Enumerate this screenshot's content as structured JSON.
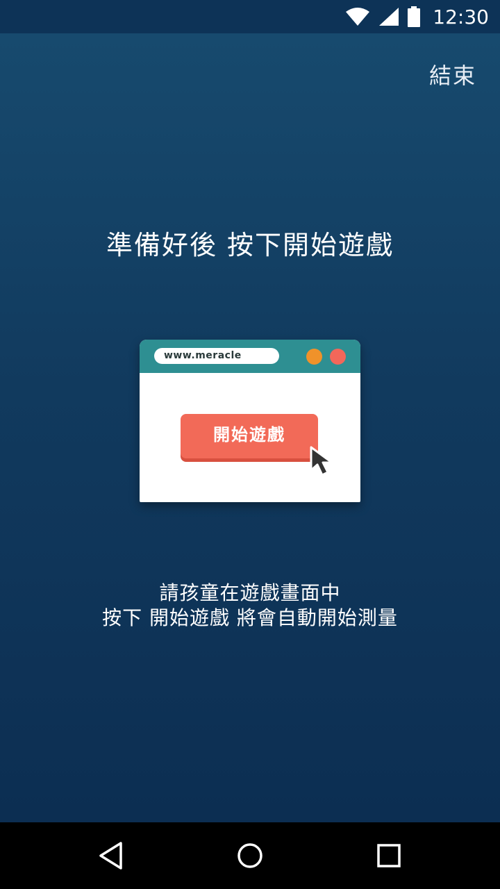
{
  "status_bar": {
    "time": "12:30",
    "icons": [
      "wifi-icon",
      "cellular-signal-icon",
      "battery-icon"
    ]
  },
  "header": {
    "end_label": "結束"
  },
  "main": {
    "headline": "準備好後 按下開始遊戲",
    "illustration": {
      "url_text": "www.meracle",
      "button_label": "開始遊戲",
      "icons": [
        "cursor-icon"
      ]
    },
    "instructions": {
      "line1": "請孩童在遊戲畫面中",
      "line2": "按下 開始遊戲 將會自動開始測量"
    }
  },
  "nav_bar": {
    "icons": [
      "back-icon",
      "home-icon",
      "recents-icon"
    ]
  },
  "colors": {
    "background_top": "#174a6e",
    "background_bottom": "#0c2e52",
    "status_bar": "#0d3357",
    "browser_bar": "#2e8f92",
    "start_button": "#f26a58",
    "dot_orange": "#f0922a",
    "dot_red": "#f2675a"
  }
}
